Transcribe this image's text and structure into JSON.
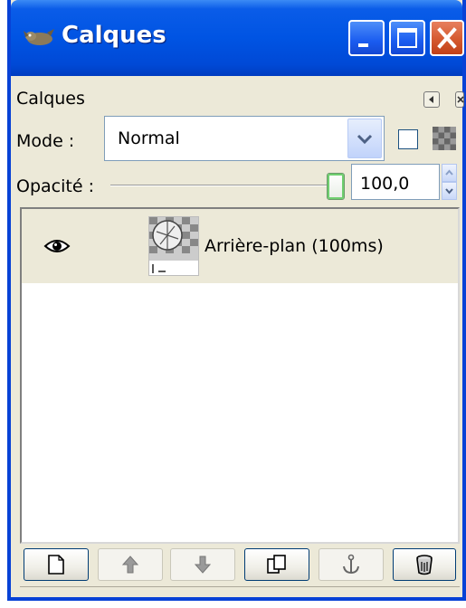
{
  "window": {
    "title": "Calques",
    "title_icon": "gimp-wilber-icon",
    "controls": [
      "minimize-icon",
      "maximize-icon",
      "close-icon"
    ]
  },
  "panel": {
    "caption": "Calques",
    "menu_icon": "panel-menu-icon",
    "close_icon": "panel-close-icon"
  },
  "mode": {
    "label": "Mode :",
    "value": "Normal",
    "keep_transparency_checked": false
  },
  "opacity": {
    "label": "Opacité :",
    "value": "100,0",
    "slider_fraction": 1.0
  },
  "layers": [
    {
      "name": "Arrière-plan (100ms)",
      "visible": true,
      "selected": true
    }
  ],
  "toolbar": {
    "buttons": [
      {
        "name": "new-layer-button",
        "icon": "new-document-icon",
        "enabled": true
      },
      {
        "name": "raise-layer-button",
        "icon": "arrow-up-icon",
        "enabled": false
      },
      {
        "name": "lower-layer-button",
        "icon": "arrow-down-icon",
        "enabled": false
      },
      {
        "name": "duplicate-layer-button",
        "icon": "duplicate-icon",
        "enabled": true
      },
      {
        "name": "anchor-layer-button",
        "icon": "anchor-icon",
        "enabled": false
      },
      {
        "name": "delete-layer-button",
        "icon": "trash-icon",
        "enabled": true
      }
    ]
  },
  "colors": {
    "titlebar": "#0054e3",
    "window_bg": "#ece9d8",
    "close_button": "#d55a2f"
  }
}
